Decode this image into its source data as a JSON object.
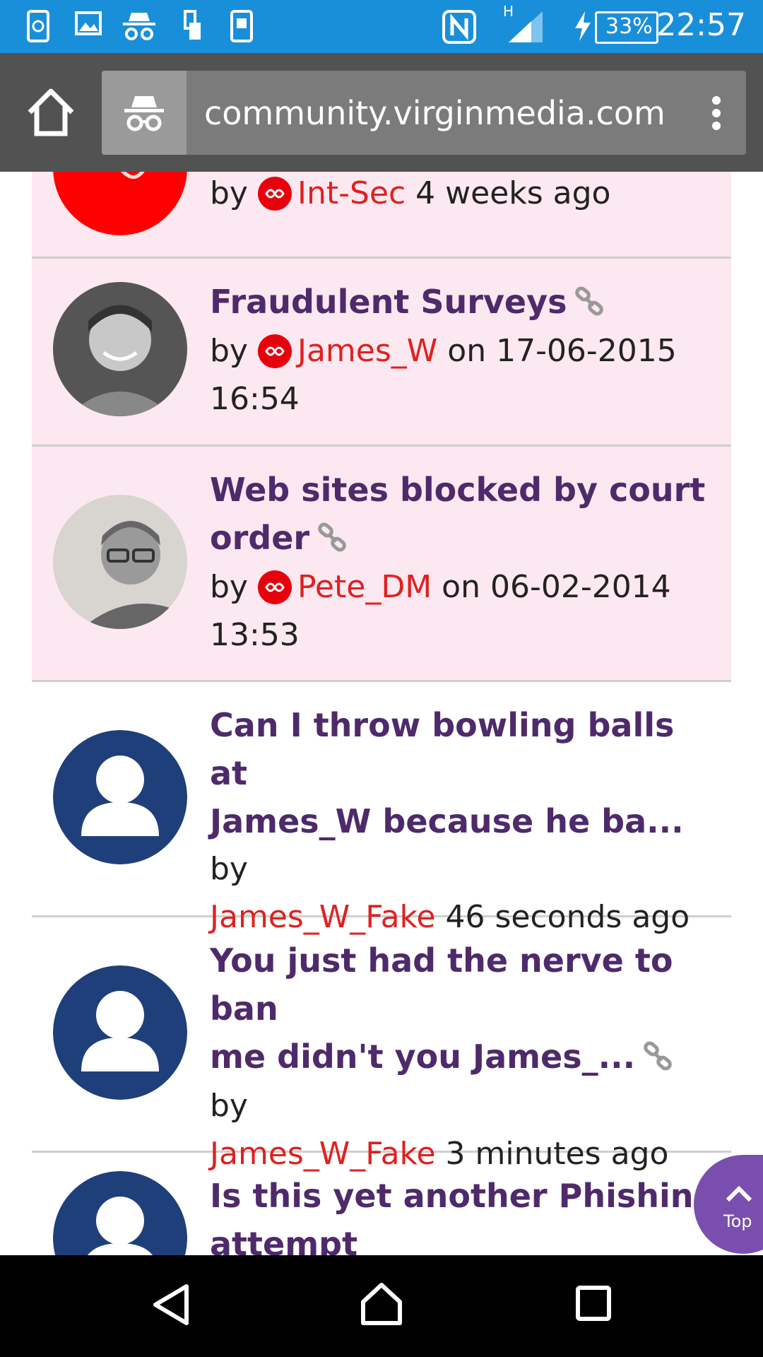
{
  "status_bar": {
    "battery": "33%",
    "time": "22:57",
    "network": "H"
  },
  "browser": {
    "url": "community.virginmedia.com"
  },
  "posts": [
    {
      "title": "",
      "by": "by",
      "author": "Int-Sec",
      "when": "4 weeks ago",
      "highlighted": true,
      "linked": false
    },
    {
      "title": "Fraudulent Surveys",
      "by": "by",
      "author": "James_W",
      "when": "on 17-06-2015",
      "when2": "16:54",
      "highlighted": true,
      "linked": true
    },
    {
      "title": "Web sites blocked by court",
      "title2": "order",
      "by": "by",
      "author": "Pete_DM",
      "when": "on 06-02-2014",
      "when2": "13:53",
      "highlighted": true,
      "linked": true
    },
    {
      "title": "Can I throw bowling balls at",
      "title2": "James_W because he ba...",
      "by": "by",
      "author": "James_W_Fake",
      "when": "46 seconds ago",
      "highlighted": false,
      "linked": false
    },
    {
      "title": "You just had the nerve to ban",
      "title2": "me didn't you James_...",
      "by": "by",
      "author": "James_W_Fake",
      "when": "3 minutes ago",
      "highlighted": false,
      "linked": true
    },
    {
      "title": "Is this yet another Phishing",
      "title2": "attempt",
      "highlighted": false,
      "linked": false
    }
  ],
  "top_button": {
    "label": "Top"
  },
  "colors": {
    "status_bar": "#1a8fd9",
    "toolbar": "#525252",
    "row_highlight": "#fce8f0",
    "title": "#4e2a6b",
    "author": "#e02020",
    "default_avatar": "#1f3f7a",
    "fab": "#7a4eae"
  }
}
